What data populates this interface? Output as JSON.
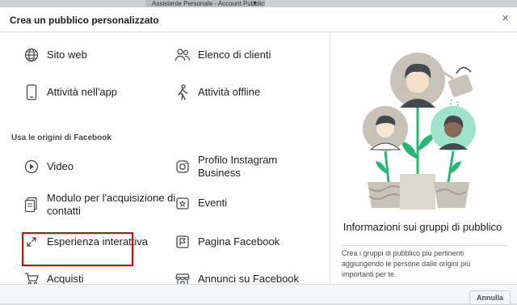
{
  "browser": {
    "tab_title": "Assistente Personale - Account Pubblicit..."
  },
  "dialog": {
    "title": "Crea un pubblico personalizzato",
    "close_symbol": "×"
  },
  "sources": {
    "own": [
      {
        "label": "Sito web",
        "icon": "globe-icon"
      },
      {
        "label": "Elenco di clienti",
        "icon": "people-icon"
      },
      {
        "label": "Attività nell'app",
        "icon": "mobile-icon"
      },
      {
        "label": "Attività offline",
        "icon": "walking-person-icon"
      }
    ],
    "facebook_section_title": "Usa le origini di Facebook",
    "facebook": [
      {
        "label": "Video",
        "icon": "play-icon"
      },
      {
        "label": "Profilo Instagram Business",
        "icon": "instagram-icon"
      },
      {
        "label": "Modulo per l'acquisizione di contatti",
        "icon": "form-icon"
      },
      {
        "label": "Eventi",
        "icon": "event-star-icon"
      },
      {
        "label": "Esperienza interattiva",
        "icon": "expand-arrows-icon"
      },
      {
        "label": "Pagina Facebook",
        "icon": "flag-icon"
      },
      {
        "label": "Acquisti",
        "icon": "shopping-cart-icon"
      },
      {
        "label": "Annunci su Facebook",
        "icon": "storefront-icon"
      }
    ]
  },
  "info_panel": {
    "title": "Informazioni sui gruppi di pubblico",
    "description": "Crea i gruppi di pubblico più pertinenti aggiungendo le persone dalle origini più importanti per te."
  },
  "footer": {
    "cancel_label": "Annulla"
  },
  "colors": {
    "highlight": "#e60000",
    "illustration_green": "#2bb673",
    "illustration_gray": "#c8c2b8"
  }
}
